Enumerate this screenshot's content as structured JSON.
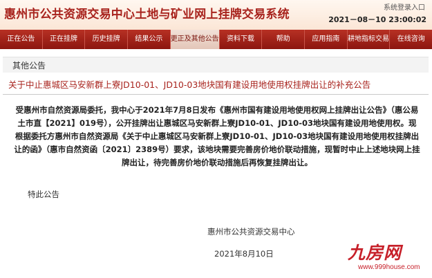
{
  "header": {
    "site_title": "惠州市公共资源交易中心土地与矿业网上挂牌交易系统",
    "login_link": "系统登录入口",
    "datetime": "2021－08－10 23:00:02"
  },
  "nav": {
    "items": [
      {
        "label": "正在公告"
      },
      {
        "label": "正在挂牌"
      },
      {
        "label": "历史挂牌"
      },
      {
        "label": "结果公示"
      },
      {
        "label": "更正及其他公告"
      },
      {
        "label": "资料下载"
      },
      {
        "label": "帮助"
      },
      {
        "label": "应用指南"
      },
      {
        "label": "耕地指标交易"
      },
      {
        "label": "在线咨询"
      }
    ],
    "active_index": 4
  },
  "section": {
    "title": "其他公告"
  },
  "notice": {
    "title": "关于中止惠城区马安新群上寮JD10-01、JD10-03地块国有建设用地使用权挂牌出让的补充公告",
    "body": "受惠州市自然资源局委托，我中心于2021年7月8日发布《惠州市国有建设用地使用权网上挂牌出让公告》（惠公易土市直【2021】019号），公开挂牌出让惠城区马安新群上寮JD10-01、JD10-03地块国有建设用地使用权。现根据委托方惠州市自然资源局《关于中止惠城区马安新群上寮JD10-01、JD10-03地块国有建设用地使用权挂牌出让的函》（惠市自然资函〔2021〕2389号）要求，该地块需要完善房价地价联动措施，现暂时中止上述地块网上挂牌出让，待完善房价地价联动措施后再恢复挂牌出让。",
    "closing": "特此公告",
    "signature_org": "惠州市公共资源交易中心",
    "signature_date": "2021年8月10日"
  },
  "watermark": {
    "brand": "九房网",
    "url": "www.999house.com"
  }
}
